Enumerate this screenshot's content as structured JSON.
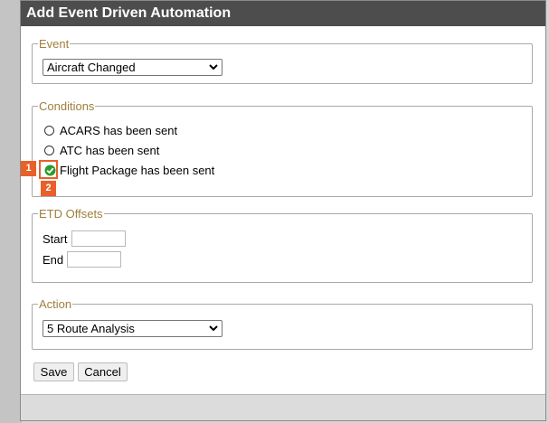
{
  "dialog": {
    "title": "Add Event Driven Automation"
  },
  "event": {
    "legend": "Event",
    "selected": "Aircraft Changed"
  },
  "conditions": {
    "legend": "Conditions",
    "options": [
      {
        "label": "ACARS has been sent",
        "checked": false
      },
      {
        "label": "ATC has been sent",
        "checked": false
      },
      {
        "label": "Flight Package has been sent",
        "checked": true
      }
    ]
  },
  "etd_offsets": {
    "legend": "ETD Offsets",
    "start_label": "Start",
    "start_value": "",
    "end_label": "End",
    "end_value": ""
  },
  "action": {
    "legend": "Action",
    "selected": "5 Route Analysis"
  },
  "buttons": {
    "save": "Save",
    "cancel": "Cancel"
  },
  "annotations": {
    "badge1": "1",
    "badge2": "2",
    "color": "#e8602a"
  },
  "colors": {
    "titlebar": "#4d4d4d",
    "legend": "#a07f3c",
    "check": "#2e9a2e"
  }
}
